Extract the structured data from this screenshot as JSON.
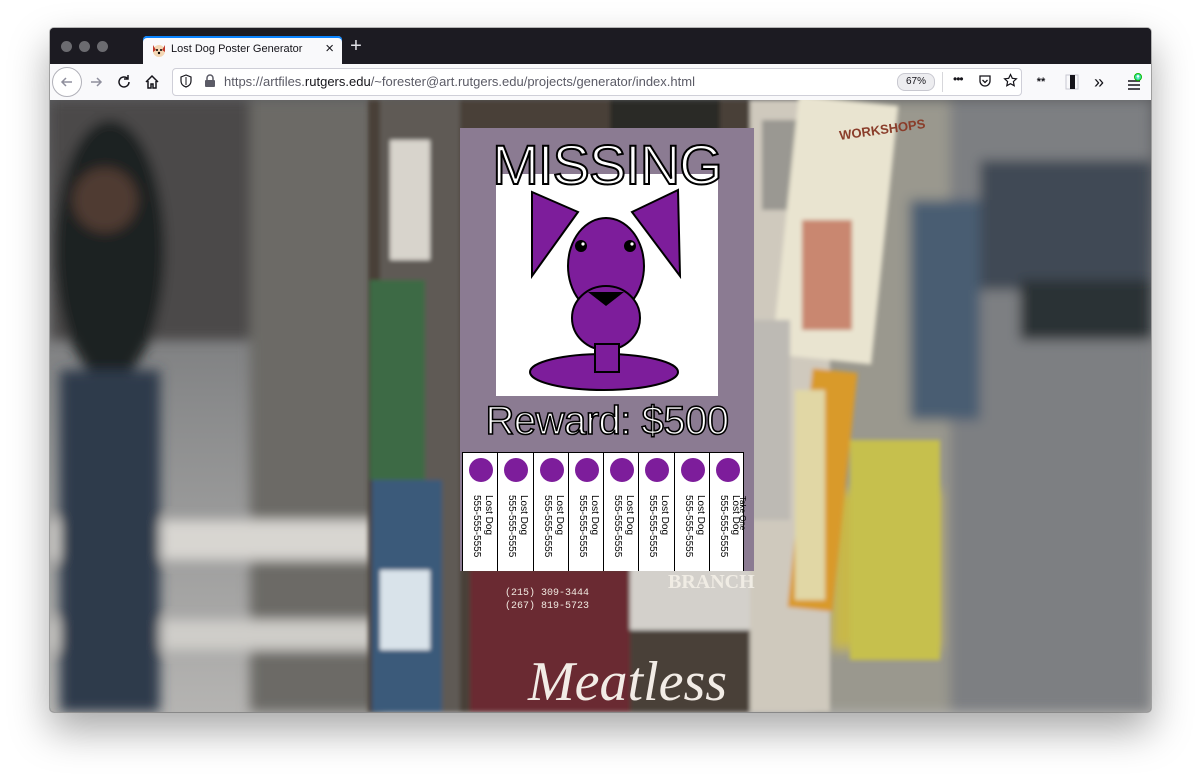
{
  "browser": {
    "tab_title": "Lost Dog Poster Generator",
    "tab_close": "×",
    "new_tab": "+",
    "url_prefix": "https://artfiles.",
    "url_domain": "rutgers.edu",
    "url_path": "/~forester@art.rutgers.edu/projects/generator/index.html",
    "zoom": "67%",
    "more": "•••",
    "overflow": "»"
  },
  "poster": {
    "headline": "MISSING",
    "reward": "Reward: $500",
    "take_one": "Take One",
    "tabs": [
      {
        "label": "Lost Dog",
        "phone": "555-555-5555"
      },
      {
        "label": "Lost Dog",
        "phone": "555-555-5555"
      },
      {
        "label": "Lost Dog",
        "phone": "555-555-5555"
      },
      {
        "label": "Lost Dog",
        "phone": "555-555-5555"
      },
      {
        "label": "Lost Dog",
        "phone": "555-555-5555"
      },
      {
        "label": "Lost Dog",
        "phone": "555-555-5555"
      },
      {
        "label": "Lost Dog",
        "phone": "555-555-5555"
      },
      {
        "label": "Lost Dog",
        "phone": "555-555-5555"
      }
    ]
  },
  "background_signs": {
    "workshops": "WORKSHOPS",
    "branch": "BRANCH",
    "meatless": "Meatless",
    "phone1": "(215) 309-3444",
    "phone2": "(267) 819-5723"
  },
  "colors": {
    "dog_purple": "#7d1d9b",
    "poster_bg": "#8b7b92",
    "accent_blue": "#0a84ff"
  }
}
